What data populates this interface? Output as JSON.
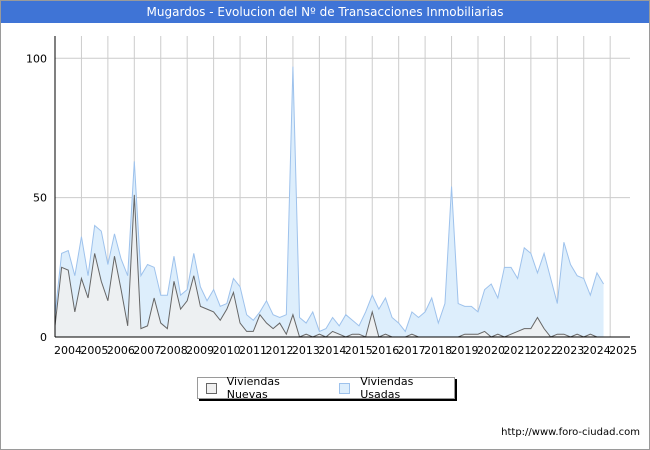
{
  "header": {
    "title": "Mugardos - Evolucion del Nº de Transacciones Inmobiliarias"
  },
  "footer": {
    "url": "http://www.foro-ciudad.com"
  },
  "colors": {
    "title_bar": "#3f74d6",
    "nuevas_line": "#666666",
    "nuevas_fill": "#f0f0f0",
    "usadas_line": "#9ec2ec",
    "usadas_fill": "#ddeefc",
    "grid": "#cccccc"
  },
  "chart_data": {
    "type": "area",
    "title": "Mugardos - Evolucion del Nº de Transacciones Inmobiliarias",
    "xlabel": "",
    "ylabel": "",
    "x_unit": "quarter",
    "x_start": "2004 Q1",
    "ylim": [
      0,
      108
    ],
    "yticks": [
      0,
      50,
      100
    ],
    "categories": [
      "2004",
      "2005",
      "2006",
      "2007",
      "2008",
      "2009",
      "2010",
      "2011",
      "2012",
      "2013",
      "2014",
      "2015",
      "2016",
      "2017",
      "2018",
      "2019",
      "2020",
      "2021",
      "2022",
      "2023",
      "2024",
      "2025"
    ],
    "grid": true,
    "legend_position": "bottom-center",
    "series": [
      {
        "name": "Viviendas Nuevas",
        "values": [
          4,
          25,
          24,
          9,
          21,
          14,
          30,
          20,
          13,
          29,
          17,
          4,
          51,
          3,
          4,
          14,
          5,
          3,
          20,
          10,
          13,
          22,
          11,
          10,
          9,
          6,
          10,
          16,
          5,
          2,
          2,
          8,
          5,
          3,
          5,
          1,
          8,
          0,
          1,
          0,
          1,
          0,
          2,
          1,
          0,
          1,
          1,
          0,
          9,
          0,
          1,
          0,
          0,
          0,
          1,
          0,
          0,
          0,
          0,
          0,
          0,
          0,
          1,
          1,
          1,
          2,
          0,
          1,
          0,
          1,
          2,
          3,
          3,
          7,
          3,
          0,
          1,
          1,
          0,
          1,
          0,
          1,
          0
        ]
      },
      {
        "name": "Viviendas Usadas",
        "values": [
          8,
          30,
          31,
          22,
          36,
          22,
          40,
          38,
          26,
          37,
          28,
          22,
          63,
          22,
          26,
          25,
          15,
          15,
          29,
          15,
          17,
          30,
          18,
          13,
          17,
          11,
          12,
          21,
          18,
          8,
          6,
          9,
          13,
          8,
          7,
          8,
          97,
          7,
          5,
          9,
          2,
          3,
          7,
          4,
          8,
          6,
          4,
          9,
          15,
          10,
          14,
          7,
          5,
          2,
          9,
          7,
          9,
          14,
          5,
          12,
          54,
          12,
          11,
          11,
          9,
          17,
          19,
          14,
          25,
          25,
          21,
          32,
          30,
          23,
          30,
          21,
          12,
          34,
          26,
          22,
          21,
          15,
          23,
          19
        ]
      }
    ]
  }
}
